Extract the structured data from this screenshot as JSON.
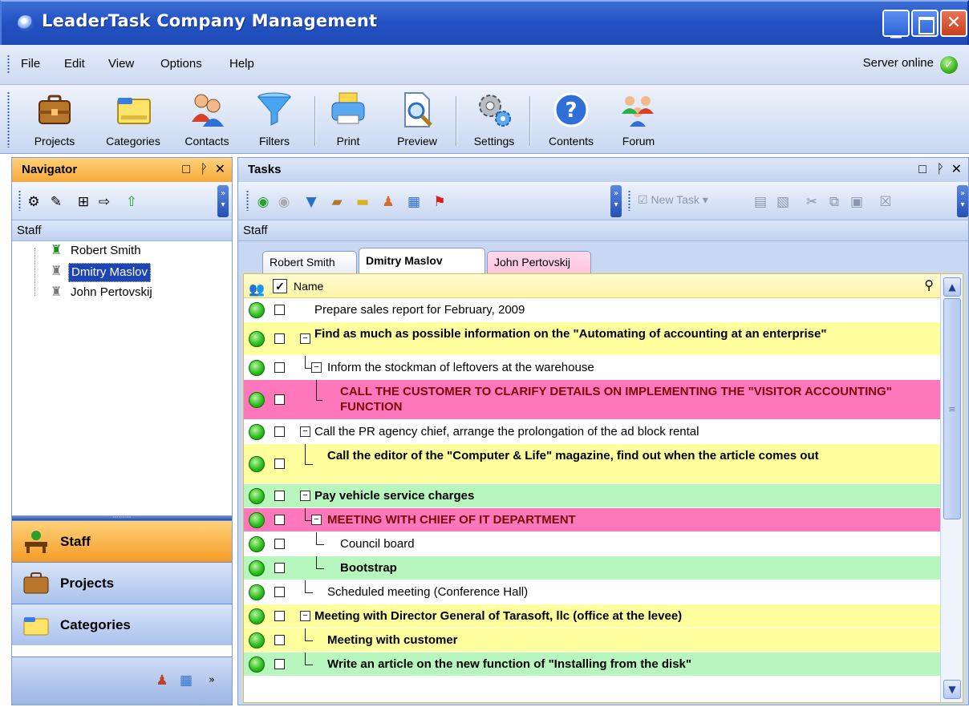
{
  "window": {
    "title": "LeaderTask Company Management"
  },
  "menu": {
    "items": [
      "File",
      "Edit",
      "View",
      "Options",
      "Help"
    ],
    "server_status": "Server online"
  },
  "toolbar": {
    "buttons": [
      "Projects",
      "Categories",
      "Contacts",
      "Filters",
      "Print",
      "Preview",
      "Settings",
      "Contents",
      "Forum"
    ]
  },
  "navigator": {
    "title": "Navigator",
    "section": "Staff",
    "staff": [
      "Robert Smith",
      "Dmitry Maslov",
      "John Pertovskij"
    ],
    "selected": "Dmitry Maslov",
    "buttons": [
      "Staff",
      "Projects",
      "Categories"
    ],
    "active_button": "Staff"
  },
  "tasks": {
    "title": "Tasks",
    "section": "Staff",
    "new_task_label": "New Task",
    "tabs": [
      "Robert Smith",
      "Dmitry Maslov",
      "John Pertovskij"
    ],
    "active_tab": "Dmitry Maslov",
    "column_name": "Name",
    "rows": [
      {
        "text": "Prepare sales report for February, 2009",
        "bg": "white",
        "bold": false
      },
      {
        "text": "Find as much as possible information on the \"Automating of accounting at an enterprise\"",
        "bg": "yellow",
        "bold": true
      },
      {
        "text": "Inform the stockman of leftovers at the warehouse",
        "bg": "white",
        "bold": false
      },
      {
        "text": "CALL THE CUSTOMER TO CLARIFY DETAILS ON IMPLEMENTING THE \"VISITOR ACCOUNTING\" FUNCTION",
        "bg": "pink",
        "bold": true
      },
      {
        "text": "Call the PR agency chief, arrange the prolongation of the ad block rental",
        "bg": "white",
        "bold": false
      },
      {
        "text": "Call the editor of the \"Computer & Life\" magazine, find out when the article comes out",
        "bg": "yellow",
        "bold": true
      },
      {
        "text": "Pay vehicle service charges",
        "bg": "green",
        "bold": true
      },
      {
        "text": "MEETING WITH CHIEF OF IT DEPARTMENT",
        "bg": "pink",
        "bold": true
      },
      {
        "text": "Council board",
        "bg": "white",
        "bold": false
      },
      {
        "text": "Bootstrap",
        "bg": "green",
        "bold": true
      },
      {
        "text": "Scheduled meeting (Conference Hall)",
        "bg": "white",
        "bold": false
      },
      {
        "text": "Meeting with Director General of Tarasoft, llc (office at the levee)",
        "bg": "yellow",
        "bold": true
      },
      {
        "text": "Meeting with customer",
        "bg": "yellow",
        "bold": true
      },
      {
        "text": "Write an article on the new function of \"Installing from the disk\"",
        "bg": "green",
        "bold": true
      }
    ]
  },
  "colors": {
    "title_blue": "#2453c4",
    "nav_active": "#f6a93a",
    "row_yellow": "#ffff9d",
    "row_pink": "#ff77bb",
    "row_green": "#b7f7bd"
  }
}
